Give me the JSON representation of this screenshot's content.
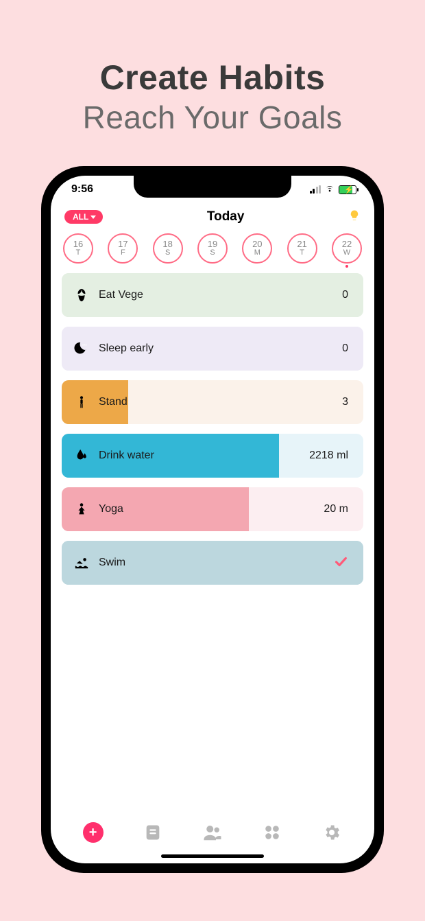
{
  "hero": {
    "title": "Create Habits",
    "subtitle": "Reach Your Goals"
  },
  "status": {
    "time": "9:56"
  },
  "header": {
    "filter_label": "ALL",
    "title": "Today"
  },
  "days": [
    {
      "num": "16",
      "dow": "T",
      "today": false
    },
    {
      "num": "17",
      "dow": "F",
      "today": false
    },
    {
      "num": "18",
      "dow": "S",
      "today": false
    },
    {
      "num": "19",
      "dow": "S",
      "today": false
    },
    {
      "num": "20",
      "dow": "M",
      "today": false
    },
    {
      "num": "21",
      "dow": "T",
      "today": false
    },
    {
      "num": "22",
      "dow": "W",
      "today": true
    }
  ],
  "habits": [
    {
      "icon": "vege-icon",
      "label": "Eat Vege",
      "value": "0",
      "bg": "#e4efe2",
      "fill_color": "#e4efe2",
      "fill_pct": 100,
      "done": false
    },
    {
      "icon": "moon-icon",
      "label": "Sleep early",
      "value": "0",
      "bg": "#eeeaf6",
      "fill_color": "#eeeaf6",
      "fill_pct": 100,
      "done": false
    },
    {
      "icon": "stand-icon",
      "label": "Stand",
      "value": "3",
      "bg": "#fbf2ea",
      "fill_color": "#eda848",
      "fill_pct": 22,
      "done": false
    },
    {
      "icon": "drop-icon",
      "label": "Drink water",
      "value": "2218 ml",
      "bg": "#e7f4f9",
      "fill_color": "#33b7d6",
      "fill_pct": 72,
      "done": false
    },
    {
      "icon": "yoga-icon",
      "label": "Yoga",
      "value": "20 m",
      "bg": "#fceef1",
      "fill_color": "#f4a7b1",
      "fill_pct": 62,
      "done": false
    },
    {
      "icon": "swim-icon",
      "label": "Swim",
      "value": "",
      "bg": "#bcd7de",
      "fill_color": "#bcd7de",
      "fill_pct": 100,
      "done": true
    }
  ],
  "colors": {
    "accent": "#ff2f6c"
  }
}
